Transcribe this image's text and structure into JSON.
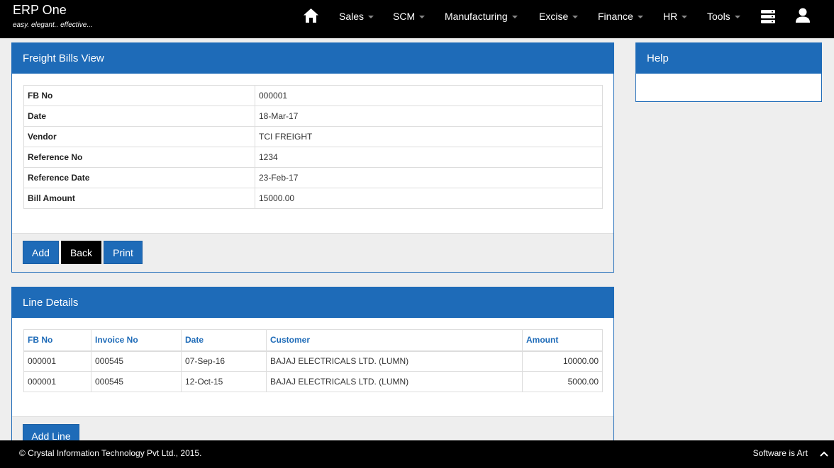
{
  "brand": {
    "name": "ERP One",
    "tagline": "easy. elegant.. effective..."
  },
  "nav": {
    "items": [
      "Sales",
      "SCM",
      "Manufacturing",
      "Excise",
      "Finance",
      "HR",
      "Tools"
    ]
  },
  "freight_panel": {
    "title": "Freight Bills View",
    "rows": [
      {
        "label": "FB No",
        "value": "000001"
      },
      {
        "label": "Date",
        "value": "18-Mar-17"
      },
      {
        "label": "Vendor",
        "value": "TCI FREIGHT"
      },
      {
        "label": "Reference No",
        "value": "1234"
      },
      {
        "label": "Reference Date",
        "value": "23-Feb-17"
      },
      {
        "label": "Bill Amount",
        "value": "15000.00"
      }
    ],
    "buttons": {
      "add": "Add",
      "back": "Back",
      "print": "Print"
    }
  },
  "help_panel": {
    "title": "Help"
  },
  "lines_panel": {
    "title": "Line Details",
    "columns": [
      "FB No",
      "Invoice No",
      "Date",
      "Customer",
      "Amount"
    ],
    "rows": [
      [
        "000001",
        "000545",
        "07-Sep-16",
        "BAJAJ ELECTRICALS LTD. (LUMN)",
        "10000.00"
      ],
      [
        "000001",
        "000545",
        "12-Oct-15",
        "BAJAJ ELECTRICALS LTD. (LUMN)",
        "5000.00"
      ]
    ],
    "add_line_label": "Add Line"
  },
  "footer": {
    "copyright": "© Crystal Information Technology Pvt Ltd., 2015.",
    "tagline": "Software is Art"
  }
}
